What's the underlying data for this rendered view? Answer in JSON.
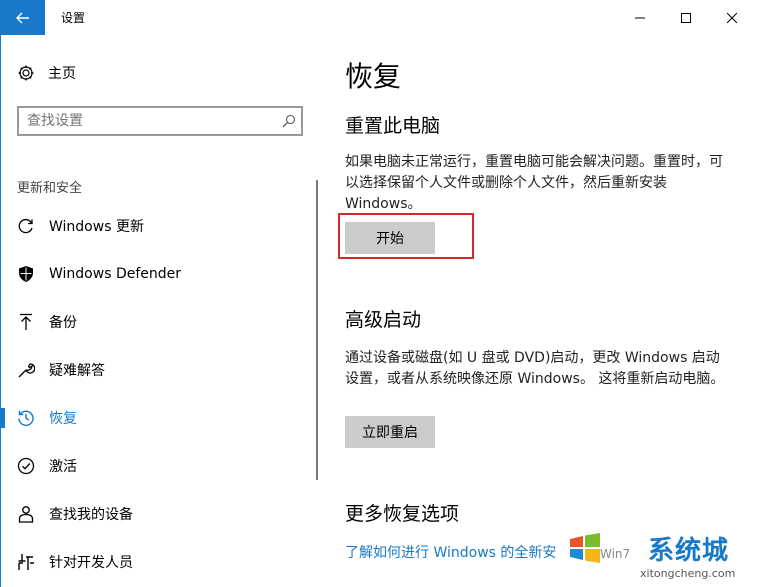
{
  "window": {
    "title": "设置"
  },
  "sidebar": {
    "home_label": "主页",
    "search_placeholder": "查找设置",
    "section_header": "更新和安全",
    "items": [
      {
        "label": "Windows 更新",
        "icon": "refresh-icon"
      },
      {
        "label": "Windows Defender",
        "icon": "shield-icon"
      },
      {
        "label": "备份",
        "icon": "backup-arrow-icon"
      },
      {
        "label": "疑难解答",
        "icon": "wrench-icon"
      },
      {
        "label": "恢复",
        "icon": "history-icon",
        "active": true
      },
      {
        "label": "激活",
        "icon": "check-circle-icon"
      },
      {
        "label": "查找我的设备",
        "icon": "person-locate-icon"
      },
      {
        "label": "针对开发人员",
        "icon": "developer-tools-icon"
      }
    ]
  },
  "main": {
    "title": "恢复",
    "reset": {
      "heading": "重置此电脑",
      "description": "如果电脑未正常运行，重置电脑可能会解决问题。重置时，可以选择保留个人文件或删除个人文件，然后重新安装 Windows。",
      "button": "开始"
    },
    "advanced": {
      "heading": "高级启动",
      "description": "通过设备或磁盘(如 U 盘或 DVD)启动，更改 Windows 启动设置，或者从系统映像还原 Windows。 这将重新启动电脑。",
      "button": "立即重启"
    },
    "more": {
      "heading": "更多恢复选项",
      "link": "了解如何进行 Windows 的全新安"
    }
  },
  "watermark": {
    "main": "系统城",
    "mid": "Win7",
    "sub": "xitongcheng.com"
  },
  "colors": {
    "accent": "#1679c9",
    "highlight": "#d9262c",
    "button_bg": "#cccccc"
  }
}
